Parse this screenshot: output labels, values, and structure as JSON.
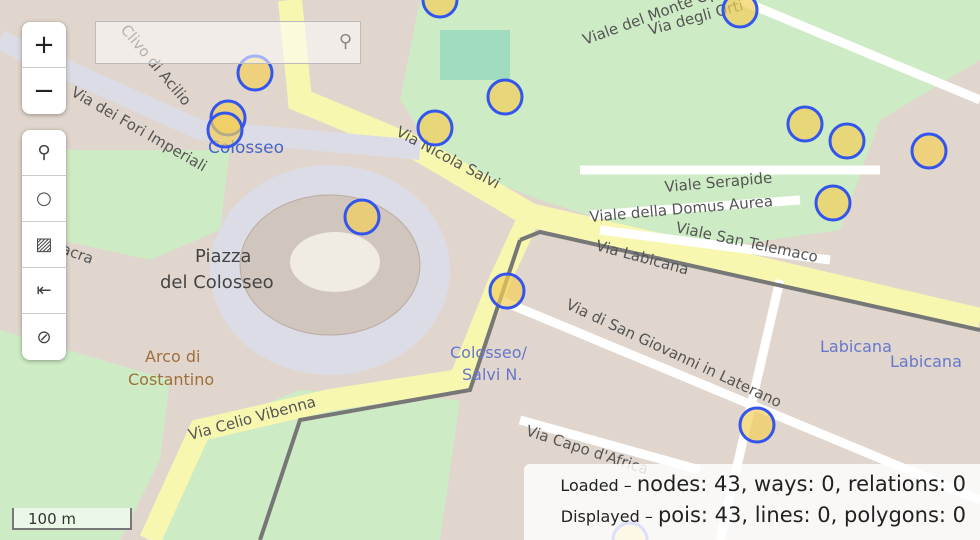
{
  "controls": {
    "zoom_in": "+",
    "zoom_out": "−",
    "tools": [
      {
        "icon": "search-icon",
        "glyph": "⚲"
      },
      {
        "icon": "circle-icon",
        "glyph": "○"
      },
      {
        "icon": "image-icon",
        "glyph": "▨"
      },
      {
        "icon": "arrow-left-bar-icon",
        "glyph": "⇤"
      },
      {
        "icon": "no-entry-icon",
        "glyph": "⊘"
      }
    ]
  },
  "search": {
    "value": "",
    "placeholder": ""
  },
  "map_labels": {
    "fori": "Via dei Fori Imperiali",
    "acilio": "Clivo di Acilio",
    "colosseo_station": "Colosseo",
    "salvi": "Via Nicola Salvi",
    "piazza1": "Piazza",
    "piazza2": "del Colosseo",
    "arco1": "Arco di",
    "arco2": "Costantino",
    "sacra": "Via Sacra",
    "celio": "Via Celio Vibenna",
    "stop1": "Colosseo/",
    "stop2": "Salvi N.",
    "labicana": "Via Labicana",
    "sgl": "Via di San Giovanni in Laterano",
    "capo": "Via Capo d'Africa",
    "lab1": "Labicana",
    "lab2": "Labicana",
    "monte": "Viale del Monte Oppio",
    "orti": "Via degli Orti",
    "serapide": "Viale Serapide",
    "domus": "Viale della Domus Aurea",
    "telemaco": "Viale San Telemaco"
  },
  "scale": "100 m",
  "stats": {
    "loaded_label": "Loaded –",
    "loaded": "nodes: 43, ways: 0, relations: 0",
    "displayed_label": "Displayed –",
    "displayed": "pois: 43, lines: 0, polygons: 0"
  },
  "colors": {
    "marker_fill": "#f2cf5a",
    "marker_stroke": "#3355ee",
    "park": "#c8f0c0",
    "road_major": "#f7f7b0",
    "road": "#ffffff",
    "plaza": "#dcdce6"
  }
}
